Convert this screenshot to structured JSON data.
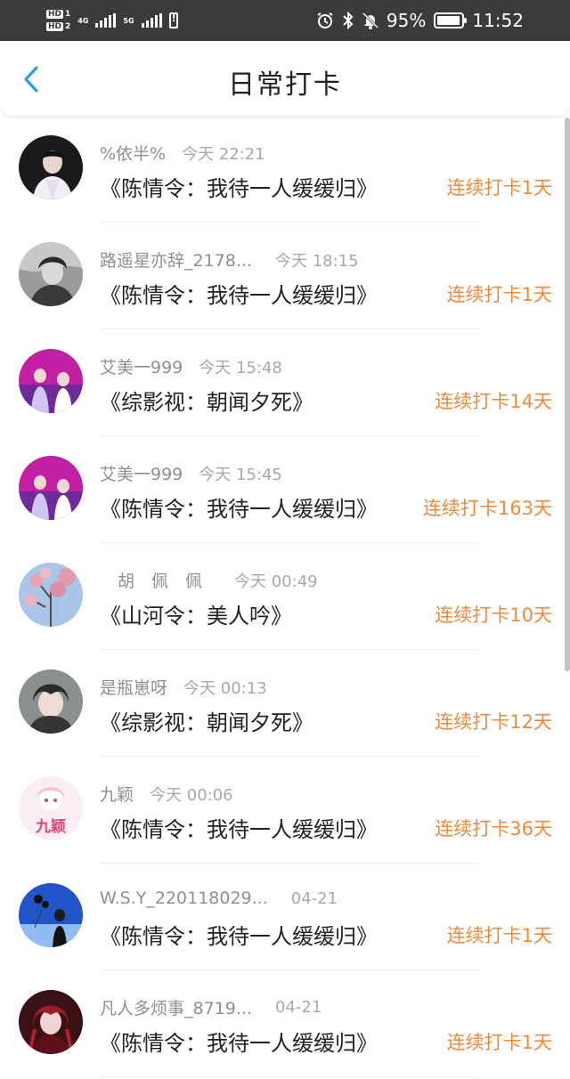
{
  "status_bar": {
    "sim1": "HD",
    "sim1_slot": "1",
    "sim2": "HD",
    "sim2_slot": "2",
    "net1": "4G",
    "net2": "5G",
    "battery": "95%",
    "battery_level": 0.95,
    "time": "11:52",
    "icons": [
      "alarm-icon",
      "bluetooth-icon",
      "mute-icon",
      "battery-icon"
    ]
  },
  "header": {
    "title": "日常打卡",
    "back_icon": "chevron-left-icon",
    "accent": "#2d9cf2"
  },
  "colors": {
    "streak": "#ee8a3d",
    "text": "#222222",
    "meta": "#8f8f8f"
  },
  "items": [
    {
      "user": "%依半%",
      "time": "今天 22:21",
      "book": "《陈情令：我待一人缓缓归》",
      "streak": "连续打卡1天"
    },
    {
      "user": "路遥星亦辞_2178...",
      "time": "今天 18:15",
      "book": "《陈情令：我待一人缓缓归》",
      "streak": "连续打卡1天"
    },
    {
      "user": "艾美一999",
      "time": "今天 15:48",
      "book": "《综影视：朝闻夕死》",
      "streak": "连续打卡14天"
    },
    {
      "user": "艾美一999",
      "time": "今天 15:45",
      "book": "《陈情令：我待一人缓缓归》",
      "streak": "连续打卡163天"
    },
    {
      "user": "胡　佩　佩",
      "time": "今天 00:49",
      "book": "《山河令：美人吟》",
      "streak": "连续打卡10天"
    },
    {
      "user": "是瓶崽呀",
      "time": "今天 00:13",
      "book": "《综影视：朝闻夕死》",
      "streak": "连续打卡12天"
    },
    {
      "user": "九颖",
      "time": "今天 00:06",
      "book": "《陈情令：我待一人缓缓归》",
      "streak": "连续打卡36天"
    },
    {
      "user": "W.S.Y_220118029...",
      "time": "04-21",
      "book": "《陈情令：我待一人缓缓归》",
      "streak": "连续打卡1天"
    },
    {
      "user": "凡人多烦事_8719...",
      "time": "04-21",
      "book": "《陈情令：我待一人缓缓归》",
      "streak": "连续打卡1天"
    }
  ],
  "avatar_logo_text": "九颖"
}
